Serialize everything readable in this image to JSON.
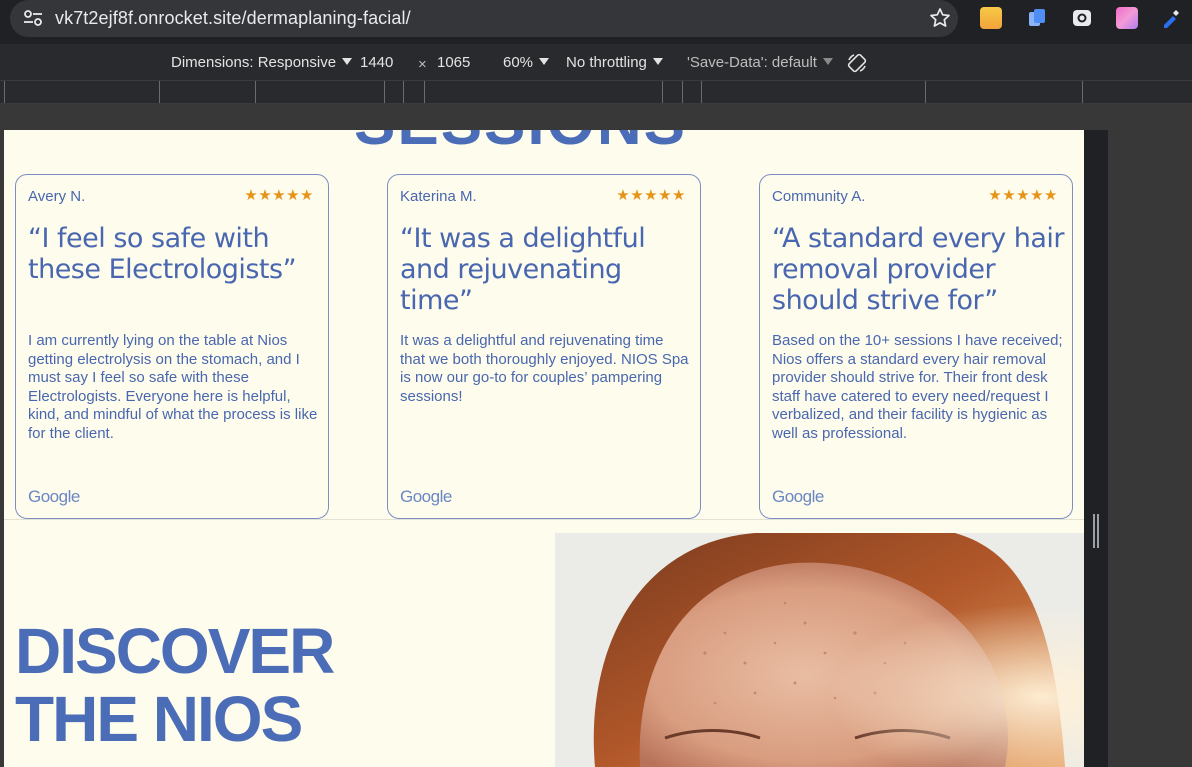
{
  "browser": {
    "url": "vk7t2ejf8f.onrocket.site/dermaplaning-facial/"
  },
  "devtools": {
    "dimensions_label": "Dimensions: Responsive",
    "width": "1440",
    "times": "×",
    "height": "1065",
    "zoom": "60%",
    "throttling": "No throttling",
    "save_data": "'Save-Data': default"
  },
  "page": {
    "sessions_heading_partial": "SESSIONS",
    "reviews": [
      {
        "name": "Avery N.",
        "stars": "★★★★★",
        "rating": 5,
        "quote": "“I feel so safe with these Electrologists”",
        "body": "I am currently lying on the table at Nios getting electrolysis on the stomach, and I must say I feel so safe with these Electrologists. Everyone here is helpful, kind, and mindful of what the process is like for the client.",
        "source": "Google"
      },
      {
        "name": "Katerina M.",
        "stars": "★★★★★",
        "rating": 5,
        "quote": "“It was a delightful and rejuvenating time”",
        "body": "It was a delightful and rejuvenating time that we both thoroughly enjoyed. NIOS Spa is now our go-to for couples’ pampering sessions!",
        "source": "Google"
      },
      {
        "name": "Community A.",
        "stars": "★★★★★",
        "rating": 5,
        "quote": "“A standard every hair removal provider should strive for”",
        "body": "Based on the 10+ sessions I have received; Nios offers a standard every hair removal provider should strive for. Their front desk staff have catered to every need/request I verbalized, and their facility is hygienic as well as professional.",
        "source": "Google"
      }
    ],
    "discover_line1": "DISCOVER",
    "discover_line2": "THE NIOS"
  },
  "colors": {
    "brand_blue": "#4b6cb7",
    "star_orange": "#e59419",
    "page_bg": "#fefcec"
  }
}
